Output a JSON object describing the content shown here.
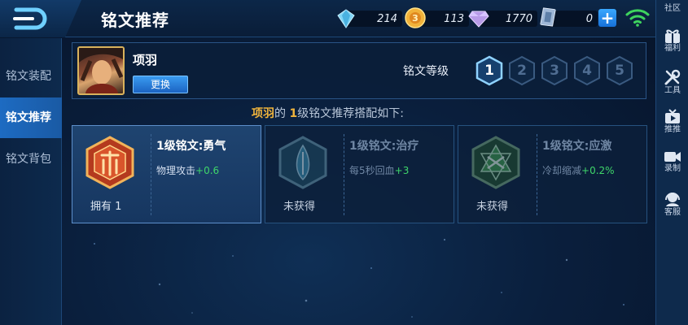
{
  "header": {
    "title": "铭文推荐"
  },
  "currencies": [
    {
      "name": "diamond",
      "value": "214",
      "icon": "blue-diamond-icon"
    },
    {
      "name": "coupon",
      "value": "113",
      "icon": "gold-coin-icon"
    },
    {
      "name": "crystal",
      "value": "1770",
      "icon": "purple-gem-icon"
    },
    {
      "name": "points",
      "value": "0",
      "icon": "silver-token-icon"
    }
  ],
  "sidebar": {
    "items": [
      {
        "label": "铭文装配",
        "active": false
      },
      {
        "label": "铭文推荐",
        "active": true
      },
      {
        "label": "铭文背包",
        "active": false
      }
    ]
  },
  "right_rail": {
    "items": [
      {
        "label": "社区"
      },
      {
        "label": "福利"
      },
      {
        "label": "工具"
      },
      {
        "label": "推推"
      },
      {
        "label": "录制"
      },
      {
        "label": "客服"
      }
    ]
  },
  "hero": {
    "name": "项羽",
    "change_label": "更换",
    "level_label": "铭文等级",
    "levels": [
      "1",
      "2",
      "3",
      "4",
      "5"
    ],
    "selected_level": "1"
  },
  "recommendation": {
    "hero_name": "项羽",
    "mid1": "的 ",
    "level": "1",
    "suffix": "级铭文推荐搭配如下:"
  },
  "cards": [
    {
      "name": "1级铭文:勇气",
      "stat_label": "物理攻击",
      "stat_value": "+0.6",
      "status": "拥有 1",
      "color": "#c2462a",
      "icon": "courage-rune-icon"
    },
    {
      "name": "1级铭文:治疗",
      "stat_label": "每5秒回血",
      "stat_value": "+3",
      "status": "未获得",
      "color": "#3a8fb0",
      "icon": "heal-rune-icon"
    },
    {
      "name": "1级铭文:应激",
      "stat_label": "冷却缩减",
      "stat_value": "+0.2%",
      "status": "未获得",
      "color": "#3f9a4a",
      "icon": "stress-rune-icon"
    }
  ],
  "colors": {
    "accent_blue": "#1d6bc2",
    "highlight_gold": "#f0b43c",
    "stat_green": "#3fd66a"
  }
}
